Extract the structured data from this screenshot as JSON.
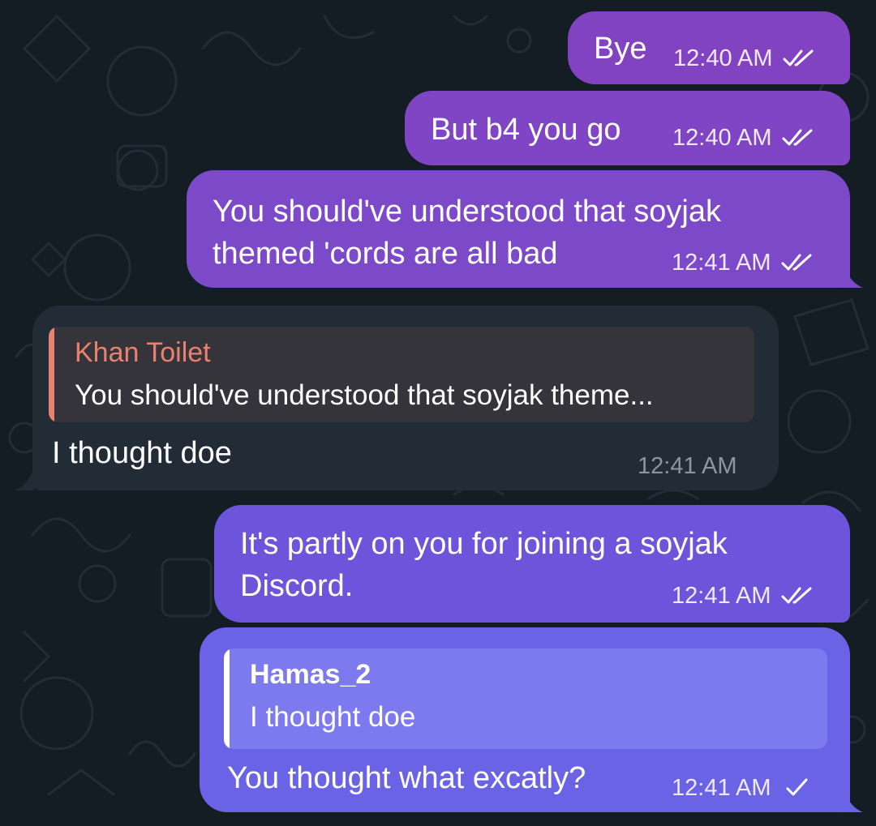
{
  "theme": {
    "background": "#141c24",
    "outgoing_bubble": "#7f48c8",
    "incoming_bubble": "#222c36",
    "quote_incoming_bg": "#35343a",
    "quote_incoming_accent": "#e8826e",
    "quote_outgoing_bg": "#7d7af0",
    "quote_outgoing_accent": "#ffffff"
  },
  "messages": [
    {
      "id": "m1",
      "direction": "outgoing",
      "text": "Bye",
      "time": "12:40 AM",
      "status": "double-check-icon"
    },
    {
      "id": "m2",
      "direction": "outgoing",
      "text": "But b4 you go",
      "time": "12:40 AM",
      "status": "double-check-icon"
    },
    {
      "id": "m3",
      "direction": "outgoing",
      "text": "You should've understood that soyjak\nthemed 'cords are all bad",
      "time": "12:41 AM",
      "status": "double-check-icon"
    },
    {
      "id": "m4",
      "direction": "incoming",
      "reply_to": {
        "name": "Khan Toilet",
        "text": "You should've understood that soyjak theme..."
      },
      "text": "I thought doe",
      "time": "12:41 AM"
    },
    {
      "id": "m5",
      "direction": "outgoing",
      "text": "It's partly on you for joining a soyjak\nDiscord.",
      "time": "12:41 AM",
      "status": "double-check-icon"
    },
    {
      "id": "m6",
      "direction": "outgoing",
      "reply_to": {
        "name": "Hamas_2",
        "text": "I thought doe"
      },
      "text": "You thought what excatly?",
      "time": "12:41 AM",
      "status": "single-check-icon"
    }
  ]
}
